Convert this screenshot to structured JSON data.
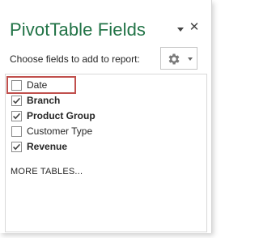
{
  "pane": {
    "title": "PivotTable Fields",
    "subtitle": "Choose fields to add to report:",
    "dropdown_icon": "chevron-down-icon",
    "close_glyph": "✕",
    "tools_icon": "gear-icon",
    "title_color": "#217346"
  },
  "fields": [
    {
      "label": "Date",
      "checked": false,
      "bold": false,
      "highlighted": true
    },
    {
      "label": "Branch",
      "checked": true,
      "bold": true,
      "highlighted": false
    },
    {
      "label": "Product Group",
      "checked": true,
      "bold": true,
      "highlighted": false
    },
    {
      "label": "Customer Type",
      "checked": false,
      "bold": false,
      "highlighted": false
    },
    {
      "label": "Revenue",
      "checked": true,
      "bold": true,
      "highlighted": false
    }
  ],
  "more_tables": "MORE TABLES...",
  "highlight_color": "#c0504d"
}
